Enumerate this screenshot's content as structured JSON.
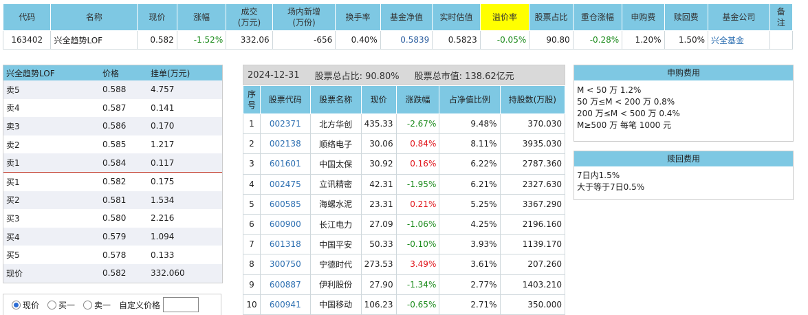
{
  "fund_table": {
    "headers": [
      "代码",
      "名称",
      "现价",
      "涨幅",
      "成交\n(万元)",
      "场内新增\n(万份)",
      "换手率",
      "基金净值",
      "实时估值",
      "溢价率",
      "股票占比",
      "重仓涨幅",
      "申购费",
      "赎回费",
      "基金公司",
      "备\n注"
    ],
    "row": {
      "code": "163402",
      "name": "兴全趋势LOF",
      "price": "0.582",
      "change": "-1.52%",
      "volume": "332.06",
      "new_shares": "-656",
      "turnover": "0.40%",
      "nav": "0.5839",
      "estimate": "0.5823",
      "premium": "-0.05%",
      "stock_ratio": "90.80",
      "holdings_change": "-0.28%",
      "sub_fee": "1.20%",
      "red_fee": "1.50%",
      "company": "兴全基金",
      "note": ""
    }
  },
  "order_book": {
    "headers": [
      "兴全趋势LOF",
      "价格",
      "挂单(万元)"
    ],
    "rows": [
      {
        "label": "卖5",
        "price": "0.588",
        "amount": "4.757"
      },
      {
        "label": "卖4",
        "price": "0.587",
        "amount": "0.141"
      },
      {
        "label": "卖3",
        "price": "0.586",
        "amount": "0.170"
      },
      {
        "label": "卖2",
        "price": "0.585",
        "amount": "1.217"
      },
      {
        "label": "卖1",
        "price": "0.584",
        "amount": "0.117"
      },
      {
        "label": "买1",
        "price": "0.582",
        "amount": "0.175"
      },
      {
        "label": "买2",
        "price": "0.581",
        "amount": "1.534"
      },
      {
        "label": "买3",
        "price": "0.580",
        "amount": "2.216"
      },
      {
        "label": "买4",
        "price": "0.579",
        "amount": "1.094"
      },
      {
        "label": "买5",
        "price": "0.578",
        "amount": "0.133"
      },
      {
        "label": "现价",
        "price": "0.582",
        "amount": "332.060"
      }
    ]
  },
  "price_options": {
    "options": [
      "现价",
      "买一",
      "卖一"
    ],
    "custom_label": "自定义价格",
    "custom_value": ""
  },
  "holdings": {
    "date": "2024-12-31",
    "stock_ratio_text": "股票总占比: 90.80%",
    "market_value_text": "股票总市值: 138.62亿元",
    "headers": [
      "序\n号",
      "股票代码",
      "股票名称",
      "现价",
      "涨跌幅",
      "占净值比例",
      "持股数(万股)"
    ],
    "rows": [
      {
        "no": "1",
        "code": "002371",
        "name": "北方华创",
        "price": "435.33",
        "change": "-2.67%",
        "ratio": "9.48%",
        "shares": "370.030"
      },
      {
        "no": "2",
        "code": "002138",
        "name": "顺络电子",
        "price": "30.06",
        "change": "0.84%",
        "ratio": "8.11%",
        "shares": "3935.030"
      },
      {
        "no": "3",
        "code": "601601",
        "name": "中国太保",
        "price": "30.92",
        "change": "0.16%",
        "ratio": "6.22%",
        "shares": "2787.360"
      },
      {
        "no": "4",
        "code": "002475",
        "name": "立讯精密",
        "price": "42.31",
        "change": "-1.95%",
        "ratio": "6.21%",
        "shares": "2327.630"
      },
      {
        "no": "5",
        "code": "600585",
        "name": "海螺水泥",
        "price": "23.31",
        "change": "0.21%",
        "ratio": "5.25%",
        "shares": "3367.290"
      },
      {
        "no": "6",
        "code": "600900",
        "name": "长江电力",
        "price": "27.09",
        "change": "-1.06%",
        "ratio": "4.25%",
        "shares": "2196.160"
      },
      {
        "no": "7",
        "code": "601318",
        "name": "中国平安",
        "price": "50.33",
        "change": "-0.10%",
        "ratio": "3.93%",
        "shares": "1139.170"
      },
      {
        "no": "8",
        "code": "300750",
        "name": "宁德时代",
        "price": "273.53",
        "change": "3.49%",
        "ratio": "3.61%",
        "shares": "207.260"
      },
      {
        "no": "9",
        "code": "600887",
        "name": "伊利股份",
        "price": "27.90",
        "change": "-1.34%",
        "ratio": "2.77%",
        "shares": "1403.210"
      },
      {
        "no": "10",
        "code": "600941",
        "name": "中国移动",
        "price": "106.23",
        "change": "-0.65%",
        "ratio": "2.71%",
        "shares": "350.000"
      }
    ]
  },
  "subscription_fee": {
    "title": "申购费用",
    "lines": [
      "M < 50 万 1.2%",
      "50 万≤M < 200 万 0.8%",
      "200 万≤M < 500 万 0.4%",
      "M≥500 万 每笔 1000 元"
    ]
  },
  "redemption_fee": {
    "title": "赎回费用",
    "lines": [
      "7日内1.5%",
      "大于等于7日0.5%"
    ]
  },
  "colors": {
    "header_bg": "#7ec8e3",
    "highlight": "#ffff00",
    "up": "#e0141a",
    "down": "#1a8a1a",
    "link": "#2a6db0"
  }
}
